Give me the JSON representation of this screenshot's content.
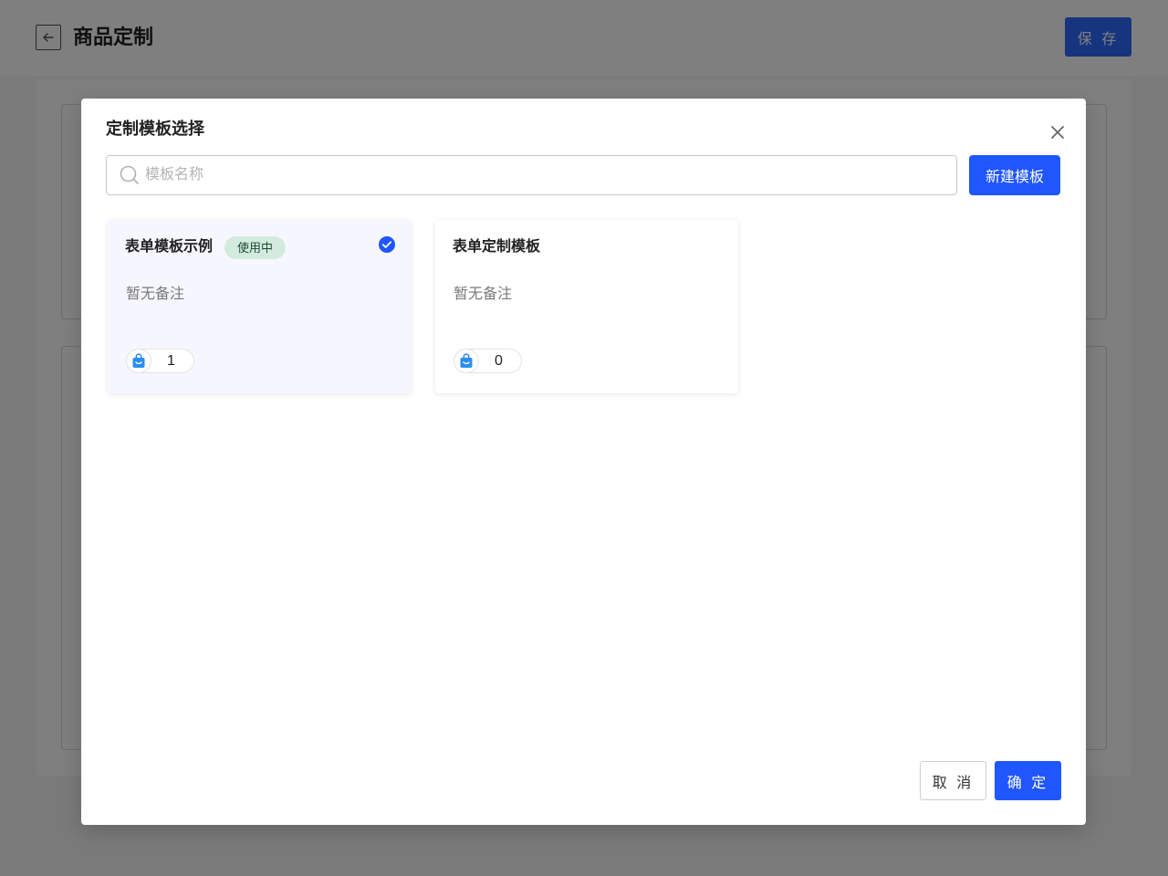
{
  "page": {
    "title": "商品定制",
    "save_label": "保 存",
    "back_icon": "arrow-left-icon"
  },
  "modal": {
    "title": "定制模板选择",
    "close_icon": "close-icon",
    "search": {
      "placeholder": "模板名称",
      "value": "",
      "icon": "search-icon"
    },
    "new_button_label": "新建模板",
    "templates": [
      {
        "name": "表单模板示例",
        "badge": "使用中",
        "selected": true,
        "note": "暂无备注",
        "product_count": "1",
        "count_icon": "shopping-bag-icon"
      },
      {
        "name": "表单定制模板",
        "badge": "",
        "selected": false,
        "note": "暂无备注",
        "product_count": "0",
        "count_icon": "shopping-bag-icon"
      }
    ],
    "cancel_label": "取 消",
    "ok_label": "确 定"
  },
  "colors": {
    "primary": "#2056ff",
    "badge_bg": "#d3ebdf",
    "badge_text": "#1e4a34",
    "selected_card_bg": "#f6f7fe",
    "overlay": "rgba(0,0,0,0.5)"
  }
}
